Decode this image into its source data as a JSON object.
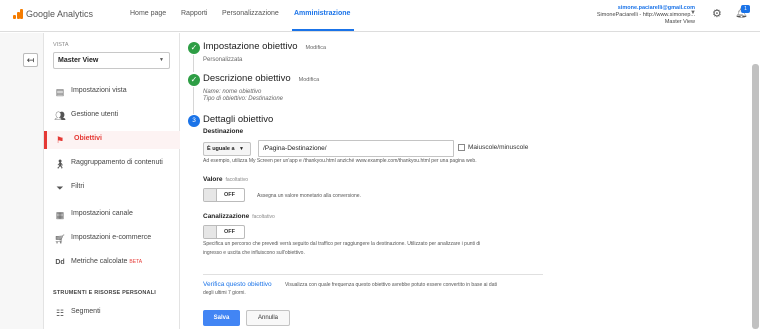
{
  "header": {
    "brand": "Google Analytics",
    "nav": [
      "Home page",
      "Rapporti",
      "Personalizzazione",
      "Amministrazione"
    ],
    "active_nav": "Amministrazione",
    "account": {
      "email": "simone.paciarelli@gmail.com",
      "property": "SimonePaciarelli - http://www.simonep...",
      "view": "Master View"
    },
    "notification_count": "1"
  },
  "sidebar": {
    "view_label": "VISTA",
    "view_selected": "Master View",
    "items": [
      {
        "label": "Impostazioni vista",
        "icon": "document-icon"
      },
      {
        "label": "Gestione utenti",
        "icon": "users-icon"
      },
      {
        "label": "Obiettivi",
        "icon": "flag-icon"
      },
      {
        "label": "Raggruppamento di contenuti",
        "icon": "person-walking-icon"
      },
      {
        "label": "Filtri",
        "icon": "filter-icon"
      },
      {
        "label": "Impostazioni canale",
        "icon": "channel-icon"
      },
      {
        "label": "Impostazioni e-commerce",
        "icon": "cart-icon"
      },
      {
        "label": "Metriche calcolate",
        "icon": "dd-icon",
        "badge": "BETA"
      }
    ],
    "active_item": "Obiettivi",
    "tools_title": "STRUMENTI E RISORSE PERSONALI",
    "tools": [
      {
        "label": "Segmenti",
        "icon": "segments-icon"
      }
    ]
  },
  "steps": [
    {
      "title": "Impostazione obiettivo",
      "edit": "Modifica",
      "summary": "Personalizzata"
    },
    {
      "title": "Descrizione obiettivo",
      "edit": "Modifica",
      "summary_lines": [
        "Name: nome obiettivo",
        "Tipo di obiettivo: Destinazione"
      ]
    },
    {
      "number": "3",
      "title": "Dettagli obiettivo"
    }
  ],
  "details": {
    "destination_label": "Destinazione",
    "match_type": "È uguale a",
    "destination_value": "/Pagina-Destinazione/",
    "case_sensitive_label": "Maiuscole/minuscole",
    "destination_hint": "Ad esempio, utilizza My Screen per un'app e /thankyou.html anziché www.example.com/thankyou.html per una pagina web.",
    "value_label": "Valore",
    "optional": "facoltativo",
    "value_toggle": "OFF",
    "value_desc": "Assegna un valore monetario alla conversione.",
    "funnel_label": "Canalizzazione",
    "funnel_toggle": "OFF",
    "funnel_desc_1": "Specifica un percorso che prevedi verrà seguito dal traffico per raggiungere la destinazione. Utilizzato per analizzare i punti di",
    "funnel_desc_2": "ingresso e uscita che influiscono sull'obiettivo.",
    "verify_link": "Verifica questo obiettivo",
    "verify_desc_1": "Visualizza con quale frequenza questo obiettivo avrebbe potuto essere convertito in base ai dati",
    "verify_desc_2": "degli ultimi 7 giorni.",
    "save_label": "Salva",
    "cancel_label": "Annulla"
  },
  "colors": {
    "accent": "#1a73e8",
    "active": "#e53935",
    "success": "#2e9e45",
    "brand": "#f57c00"
  }
}
